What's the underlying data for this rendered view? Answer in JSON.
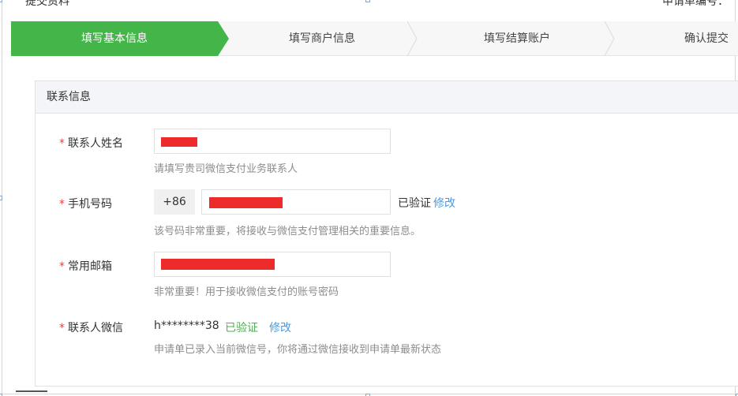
{
  "header": {
    "title": "提交资料",
    "right_text": "申请单编号："
  },
  "steps": [
    {
      "label": "填写基本信息",
      "active": true
    },
    {
      "label": "填写商户信息",
      "active": false
    },
    {
      "label": "填写结算账户",
      "active": false
    },
    {
      "label": "确认提交",
      "active": false
    }
  ],
  "section": {
    "title": "联系信息"
  },
  "form": {
    "contact_name": {
      "required_mark": "*",
      "label": "联系人姓名",
      "hint": "请填写贵司微信支付业务联系人"
    },
    "phone": {
      "required_mark": "*",
      "label": "手机号码",
      "prefix": "+86",
      "status": "已验证",
      "modify": "修改",
      "hint": "该号码非常重要，将接收与微信支付管理相关的重要信息。"
    },
    "email": {
      "required_mark": "*",
      "label": "常用邮箱",
      "hint": "非常重要！用于接收微信支付的账号密码"
    },
    "wechat": {
      "required_mark": "*",
      "label": "联系人微信",
      "value": "h********38",
      "status": "已验证",
      "modify": "修改",
      "hint": "申请单已录入当前微信号，你将通过微信接收到申请单最新状态"
    }
  },
  "colors": {
    "accent_green": "#44b549",
    "link_blue": "#459ae9",
    "required_red": "#e64340",
    "redaction": "#ee2b2b"
  }
}
